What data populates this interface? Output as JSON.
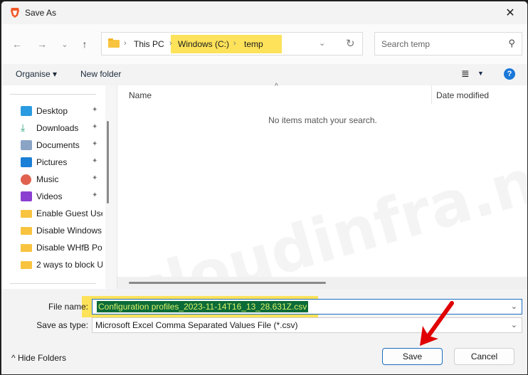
{
  "window": {
    "title": "Save As",
    "app_icon": "brave-lion-icon",
    "close": "✕"
  },
  "nav": {
    "back": "←",
    "forward": "→",
    "recent": "⌄",
    "up": "↑",
    "breadcrumb": [
      {
        "label": "This PC"
      },
      {
        "label": "Windows (C:)"
      },
      {
        "label": "temp"
      }
    ],
    "separator": "›",
    "dropdown": "⌄",
    "refresh": "↻"
  },
  "search": {
    "placeholder": "Search temp",
    "icon": "⚲"
  },
  "toolbar": {
    "organise": "Organise ▾",
    "new_folder": "New folder",
    "view_icon": "≣",
    "view_dd": "▼",
    "help": "?"
  },
  "sidebar": {
    "items": [
      {
        "label": "Desktop",
        "icon": "desktop-icon",
        "pinned": true,
        "color": "#2a9be0"
      },
      {
        "label": "Downloads",
        "icon": "download-icon",
        "pinned": true,
        "color": "#2aa37a"
      },
      {
        "label": "Documents",
        "icon": "documents-icon",
        "pinned": true,
        "color": "#8aa4c6"
      },
      {
        "label": "Pictures",
        "icon": "pictures-icon",
        "pinned": true,
        "color": "#1a7fd6"
      },
      {
        "label": "Music",
        "icon": "music-icon",
        "pinned": true,
        "color": "#e0624e"
      },
      {
        "label": "Videos",
        "icon": "videos-icon",
        "pinned": true,
        "color": "#8a3fd1"
      },
      {
        "label": "Enable Guest User",
        "icon": "folder-icon",
        "pinned": false,
        "color": "#f8c43f"
      },
      {
        "label": "Disable Windows",
        "icon": "folder-icon",
        "pinned": false,
        "color": "#f8c43f"
      },
      {
        "label": "Disable WHfB Pos",
        "icon": "folder-icon",
        "pinned": false,
        "color": "#f8c43f"
      },
      {
        "label": "2 ways to block U",
        "icon": "folder-icon",
        "pinned": false,
        "color": "#f8c43f"
      }
    ],
    "pin_glyph": "📌"
  },
  "content": {
    "columns": [
      {
        "label": "Name"
      },
      {
        "label": "Date modified"
      }
    ],
    "sort_caret": "^",
    "empty_message": "No items match your search.",
    "watermark": "cloudinfra.net"
  },
  "form": {
    "file_name_label": "File name:",
    "file_name_value": "Configuration profiles_2023-11-14T16_13_28.631Z.csv",
    "save_type_label": "Save as type:",
    "save_type_value": "Microsoft Excel Comma Separated Values File (*.csv)",
    "dropdown": "⌄"
  },
  "footer": {
    "hide_folders": "^  Hide Folders",
    "save": "Save",
    "cancel": "Cancel"
  },
  "colors": {
    "highlight": "#fde25a",
    "selection_bg": "#0b6b39",
    "selection_fg": "#d9f26b",
    "accent": "#1a6fc1",
    "arrow": "#e00000"
  }
}
